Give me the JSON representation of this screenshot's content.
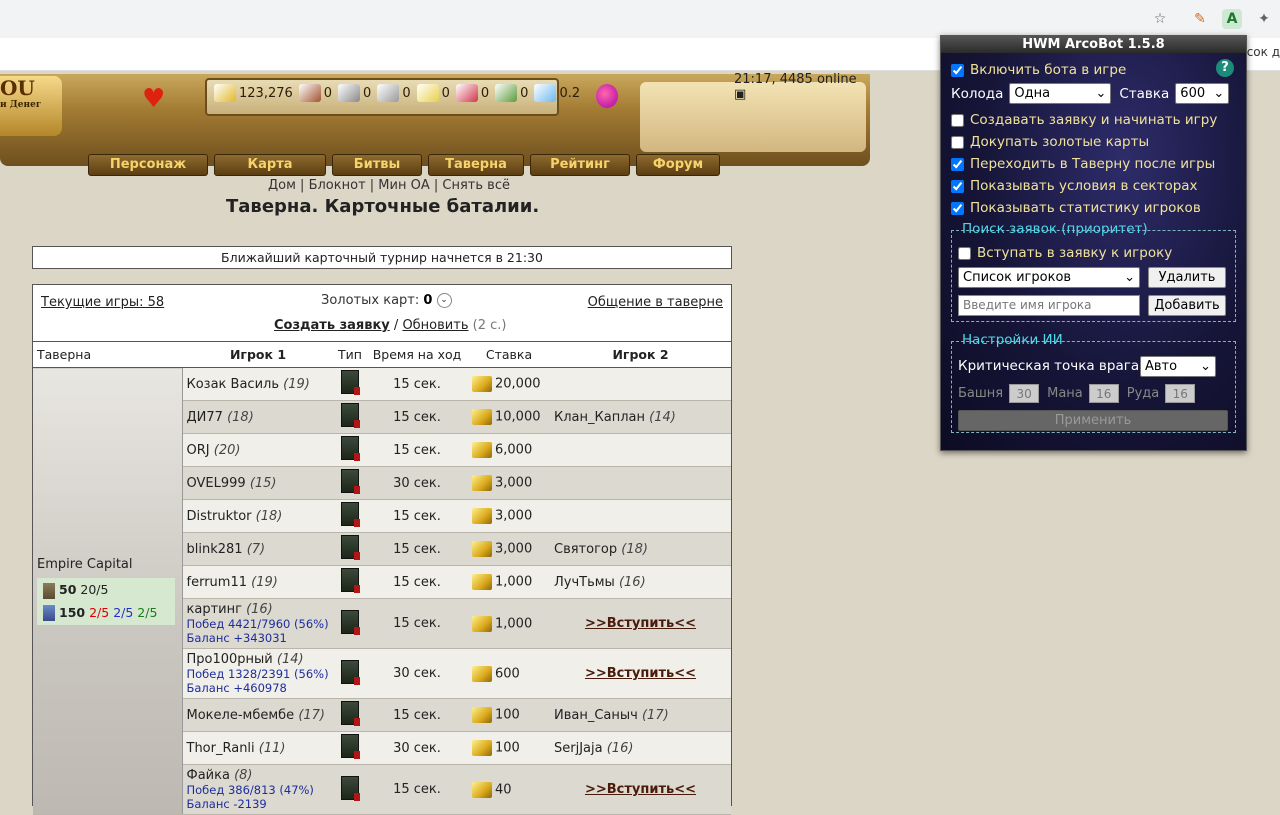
{
  "browser": {
    "bookmark_text": "писок д"
  },
  "header": {
    "time_online": "21:17, 4485 online",
    "logo_text": "ОU",
    "logo_sub": "и Денег",
    "resources": [
      {
        "name": "gold",
        "value": "123,276",
        "color": "#e2b72a"
      },
      {
        "name": "wood",
        "value": "0",
        "color": "#a0522d"
      },
      {
        "name": "ore",
        "value": "0",
        "color": "#888888"
      },
      {
        "name": "mercury",
        "value": "0",
        "color": "#9a9a9a"
      },
      {
        "name": "sulfur",
        "value": "0",
        "color": "#e8d04a"
      },
      {
        "name": "crystals",
        "value": "0",
        "color": "#d0344a"
      },
      {
        "name": "gems",
        "value": "0",
        "color": "#5b9a3b"
      },
      {
        "name": "diamonds",
        "value": "0.2",
        "color": "#6ab9f0"
      }
    ],
    "nav": [
      "Персонаж",
      "Карта",
      "Битвы",
      "Таверна",
      "Рейтинг",
      "Форум"
    ],
    "subnav": [
      "Дом",
      "Блокнот",
      "Мин ОА",
      "Снять всё"
    ],
    "page_title": "Таверна. Карточные баталии."
  },
  "tournament_notice": "Ближайший карточный турнир начнется в 21:30",
  "main": {
    "current_games": "Текущие игры: 58",
    "gold_cards_label": "Золотых карт:",
    "gold_cards_value": "0",
    "tavern_chat": "Общение в таверне",
    "create_request": "Создать заявку",
    "refresh": "Обновить",
    "refresh_hint": "(2 с.)",
    "columns": [
      "Таверна",
      "Игрок 1",
      "Тип",
      "Время на ход",
      "Ставка",
      "Игрок 2"
    ],
    "tavern": {
      "name": "Empire Capital",
      "stat1_num": "50",
      "stat1_rest": "20/5",
      "stat2_num": "150",
      "stat2_a": "2/5",
      "stat2_b": "2/5",
      "stat2_c": "2/5"
    },
    "rows": [
      {
        "p1": "Козак Василь",
        "lvl1": "(19)",
        "time": "15 сек.",
        "bet": "20,000",
        "p2": "",
        "lvl2": ""
      },
      {
        "p1": "ДИ77",
        "lvl1": "(18)",
        "time": "15 сек.",
        "bet": "10,000",
        "p2": "Клан_Каплан",
        "lvl2": "(14)"
      },
      {
        "p1": "ORJ",
        "lvl1": "(20)",
        "time": "15 сек.",
        "bet": "6,000",
        "p2": "",
        "lvl2": ""
      },
      {
        "p1": "OVEL999",
        "lvl1": "(15)",
        "time": "30 сек.",
        "bet": "3,000",
        "p2": "",
        "lvl2": ""
      },
      {
        "p1": "Distruktor",
        "lvl1": "(18)",
        "time": "15 сек.",
        "bet": "3,000",
        "p2": "",
        "lvl2": ""
      },
      {
        "p1": "blink281",
        "lvl1": "(7)",
        "time": "15 сек.",
        "bet": "3,000",
        "p2": "Святогор",
        "lvl2": "(18)"
      },
      {
        "p1": "ferrum11",
        "lvl1": "(19)",
        "time": "15 сек.",
        "bet": "1,000",
        "p2": "ЛучТьмы",
        "lvl2": "(16)"
      },
      {
        "p1": "картинг",
        "lvl1": "(16)",
        "wins": "Побед 4421/7960 (56%)",
        "balance": "Баланс +343031",
        "time": "15 сек.",
        "bet": "1,000",
        "join": ">>Вступить<<"
      },
      {
        "p1": "Про100рный",
        "lvl1": "(14)",
        "wins": "Побед 1328/2391 (56%)",
        "balance": "Баланс +460978",
        "time": "30 сек.",
        "bet": "600",
        "join": ">>Вступить<<"
      },
      {
        "p1": "Мокеле-мбембе",
        "lvl1": "(17)",
        "time": "15 сек.",
        "bet": "100",
        "p2": "Иван_Саныч",
        "lvl2": "(17)"
      },
      {
        "p1": "Thor_Ranli",
        "lvl1": "(11)",
        "time": "30 сек.",
        "bet": "100",
        "p2": "SerjJaja",
        "lvl2": "(16)"
      },
      {
        "p1": "Файка",
        "lvl1": "(8)",
        "wins": "Побед 386/813 (47%)",
        "balance": "Баланс -2139",
        "time": "15 сек.",
        "bet": "40",
        "join": ">>Вступить<<"
      }
    ]
  },
  "arcobot": {
    "title": "HWM ArcoBot 1.5.8",
    "help": "?",
    "enable_bot": "Включить бота в игре",
    "deck_label": "Колода",
    "deck_value": "Одна",
    "bet_label": "Ставка",
    "bet_value": "600",
    "create_and_start": "Создавать заявку и начинать игру",
    "buy_gold_cards": "Докупать золотые карты",
    "go_tavern": "Переходить в Таверну после игры",
    "show_conditions": "Показывать условия в секторах",
    "show_stats": "Показывать статистику игроков",
    "search_legend": "Поиск заявок (приоритет)",
    "join_player": "Вступать в заявку к игроку",
    "players_list": "Список игроков",
    "delete_btn": "Удалить",
    "player_placeholder": "Введите имя игрока",
    "add_btn": "Добавить",
    "ai_legend": "Настройки ИИ",
    "critical_label": "Критическая точка врага",
    "critical_value": "Авто",
    "tower_label": "Башня",
    "tower_value": "30",
    "mana_label": "Мана",
    "mana_value": "16",
    "ore_label": "Руда",
    "ore_value": "16",
    "apply_btn": "Применить",
    "checks": {
      "enable_bot": true,
      "create_and_start": false,
      "buy_gold_cards": false,
      "go_tavern": true,
      "show_conditions": true,
      "show_stats": true,
      "join_player": false
    }
  }
}
